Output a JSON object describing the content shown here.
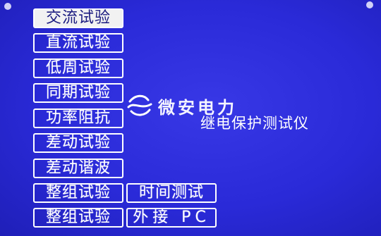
{
  "menu": {
    "items": [
      {
        "label": "交流试验",
        "selected": true
      },
      {
        "label": "直流试验",
        "selected": false
      },
      {
        "label": "低周试验",
        "selected": false
      },
      {
        "label": "同期试验",
        "selected": false
      },
      {
        "label": "功率阻抗",
        "selected": false
      },
      {
        "label": "差动试验",
        "selected": false
      },
      {
        "label": "差动谐波",
        "selected": false
      },
      {
        "label": "整组试验",
        "selected": false
      },
      {
        "label": "整组试验",
        "selected": false
      }
    ],
    "side_items": [
      {
        "label": "时间测试"
      },
      {
        "label": "外接 PC"
      }
    ]
  },
  "brand": {
    "logo_text": "微安电力",
    "logo_icon": "wave-s-logo-icon",
    "product_name": "继电保护测试仪"
  },
  "colors": {
    "screen_background": "#2a2ad8",
    "foreground": "#ffffff",
    "selected_background": "#f2f2f2",
    "selected_text": "#1b1b80"
  }
}
